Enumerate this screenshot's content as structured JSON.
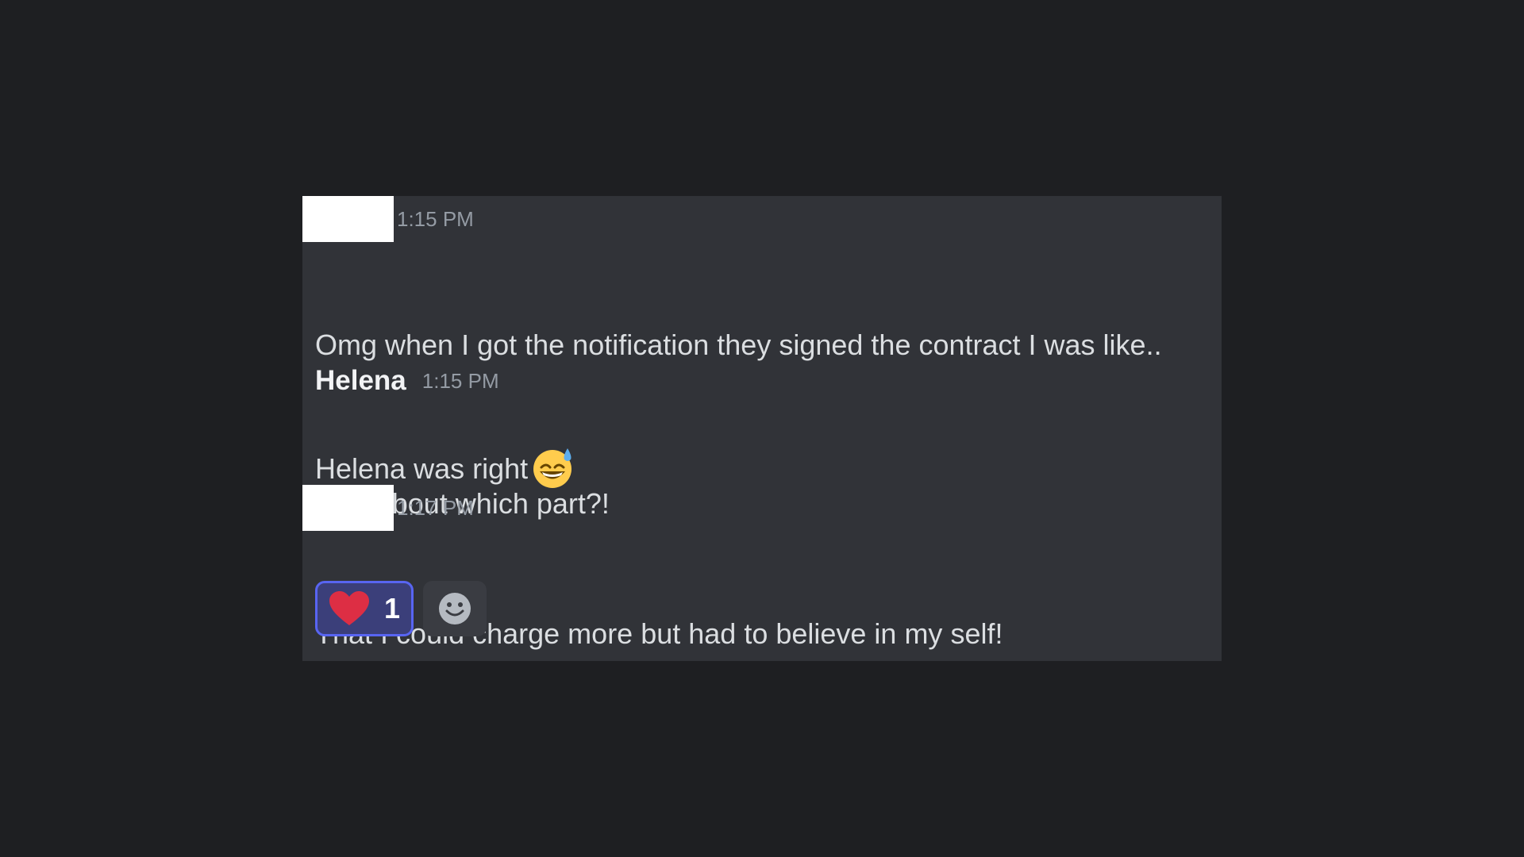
{
  "messages": [
    {
      "timestamp": "1:15 PM",
      "lines": [
        "Omg when I got the notification they signed the contract I was like..",
        "Helena was right"
      ],
      "emoji": "sweat-smile-emoji"
    },
    {
      "author": "Helena",
      "timestamp": "1:15 PM",
      "lines": [
        "LOL about which part?!"
      ]
    },
    {
      "timestamp": "1:17 PM",
      "lines": [
        "That I could charge more but had to believe in my self!"
      ],
      "reactions": [
        {
          "emoji": "heart-emoji",
          "count": "1",
          "active": true
        }
      ],
      "add_reaction_icon": "smiley-add-reaction-icon"
    }
  ],
  "colors": {
    "background": "#1e1f22",
    "panel": "#313338",
    "text": "#dbdee1",
    "timestamp": "#949ba4",
    "reaction_active_bg": "#3b3f7a",
    "reaction_active_border": "#5865f2",
    "heart": "#dd2e44"
  }
}
